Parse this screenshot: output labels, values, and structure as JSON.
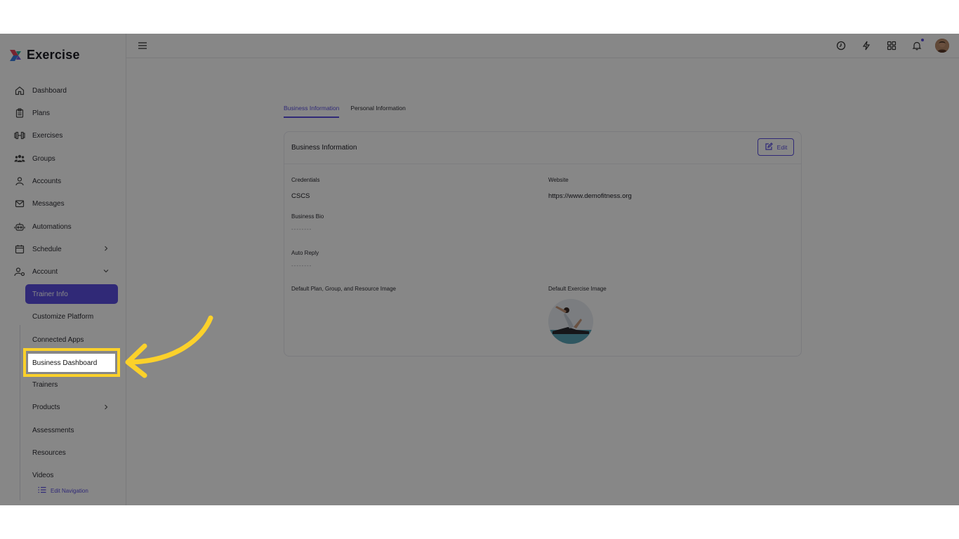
{
  "app": {
    "name": "Exercise"
  },
  "sidebar": {
    "items": [
      {
        "label": "Dashboard",
        "icon": "home-icon"
      },
      {
        "label": "Plans",
        "icon": "clipboard-icon"
      },
      {
        "label": "Exercises",
        "icon": "dumbbell-icon"
      },
      {
        "label": "Groups",
        "icon": "users-icon"
      },
      {
        "label": "Accounts",
        "icon": "user-icon"
      },
      {
        "label": "Messages",
        "icon": "mail-icon"
      },
      {
        "label": "Automations",
        "icon": "robot-icon"
      },
      {
        "label": "Schedule",
        "icon": "calendar-icon"
      },
      {
        "label": "Account",
        "icon": "user-gear-icon"
      }
    ],
    "account_sub": [
      {
        "label": "Trainer Info"
      },
      {
        "label": "Customize Platform"
      },
      {
        "label": "Connected Apps"
      },
      {
        "label": "Business Dashboard"
      },
      {
        "label": "Trainers"
      },
      {
        "label": "Products"
      },
      {
        "label": "Assessments"
      },
      {
        "label": "Resources"
      },
      {
        "label": "Videos"
      }
    ],
    "edit_navigation": "Edit Navigation"
  },
  "tabs": [
    {
      "label": "Business Information"
    },
    {
      "label": "Personal Information"
    }
  ],
  "card": {
    "title": "Business Information",
    "edit_label": "Edit",
    "credentials_label": "Credentials",
    "credentials_value": "CSCS",
    "website_label": "Website",
    "website_value": "https://www.demofitness.org",
    "bio_label": "Business Bio",
    "bio_value": "--------",
    "auto_reply_label": "Auto Reply",
    "auto_reply_value": "--------",
    "default_plan_image_label": "Default Plan, Group, and Resource Image",
    "default_exercise_image_label": "Default Exercise Image"
  },
  "colors": {
    "accent": "#5b4fe0",
    "highlight": "#fcd12a"
  }
}
